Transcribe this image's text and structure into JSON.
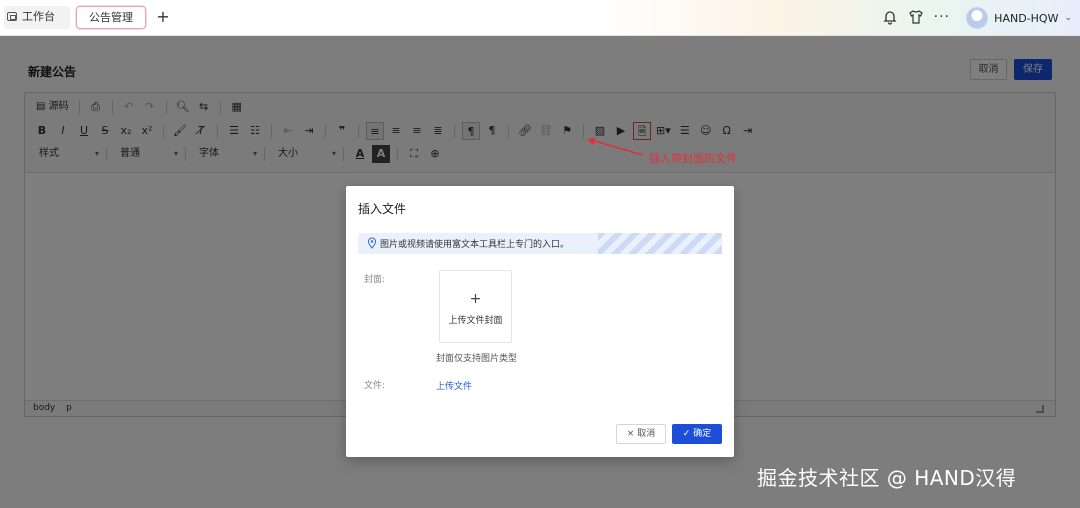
{
  "topbar": {
    "tabs": [
      {
        "label": "工作台"
      },
      {
        "label": "公告管理"
      }
    ],
    "add_tab": "+",
    "more": "···",
    "user_name": "HAND-HQW"
  },
  "page": {
    "title": "新建公告",
    "cancel_label": "取消",
    "save_label": "保存"
  },
  "toolbar": {
    "row1": [
      "源码",
      "预览",
      "撤销",
      "重做",
      "查找",
      "替换",
      "模板"
    ],
    "row2": [
      "B",
      "I",
      "U",
      "S",
      "x₂",
      "x²",
      "格式刷",
      "清除格式",
      "有序列表",
      "无序列表",
      "减少缩进",
      "增加缩进",
      "引用",
      "左对齐",
      "居中",
      "右对齐",
      "两端对齐",
      "从左到右",
      "从右到左",
      "链接",
      "取消链接",
      "锚点",
      "图片",
      "视频",
      "文件",
      "表格",
      "分隔线",
      "表情",
      "特殊字符",
      "插入"
    ],
    "row3": {
      "style": "样式",
      "paragraph": "普通",
      "font": "字体",
      "size": "大小",
      "text_color": "A",
      "bg_color": "A"
    }
  },
  "editor_footer": [
    "body",
    "p"
  ],
  "annotation": "插入带封面的文件",
  "modal": {
    "title": "插入文件",
    "notice": "图片或视频请使用富文本工具栏上专门的入口。",
    "cover_label": "封面:",
    "cover_upload_plus": "+",
    "cover_upload_label": "上传文件封面",
    "cover_hint": "封面仅支持图片类型",
    "file_label": "文件:",
    "file_upload": "上传文件",
    "cancel": "× 取消",
    "ok": "✓ 确定"
  },
  "watermark": "掘金技术社区 @ HAND汉得",
  "colors": {
    "primary": "#1d4ed8",
    "annotation": "#e0303a",
    "link": "#1f5cd6"
  }
}
